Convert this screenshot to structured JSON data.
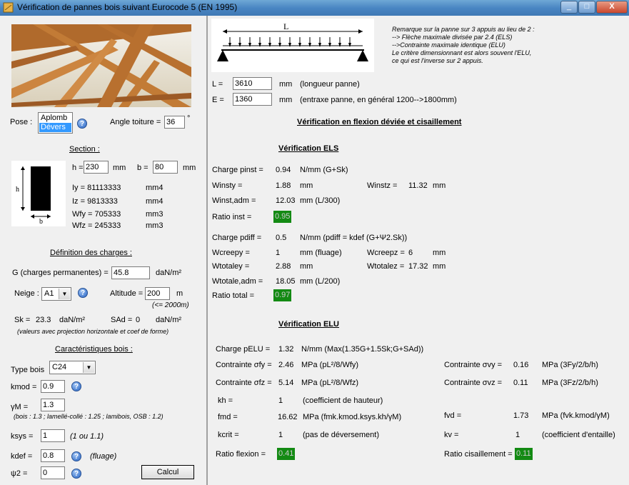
{
  "window": {
    "title": "Vérification de pannes bois suivant Eurocode 5 (EN 1995)",
    "btn_min": "_",
    "btn_max": "□",
    "btn_close": "X"
  },
  "pose": {
    "label": "Pose :",
    "options": [
      "Aplomb",
      "Dévers"
    ],
    "angle_label": "Angle toiture =",
    "angle_value": "36",
    "angle_unit": "°"
  },
  "section": {
    "heading": "Section :",
    "h_label": "h =",
    "h_value": "230",
    "h_unit": "mm",
    "b_label": "b =",
    "b_value": "80",
    "b_unit": "mm",
    "sketch_h": "h",
    "sketch_b": "b",
    "iy": "Iy = 81113333",
    "iy_unit": "mm4",
    "iz": "Iz = 9813333",
    "iz_unit": "mm4",
    "wfy": "Wfy = 705333",
    "wfy_unit": "mm3",
    "wfz": "Wfz = 245333",
    "wfz_unit": "mm3"
  },
  "charges": {
    "heading": "Définition des charges :",
    "g_label": "G (charges permanentes) =",
    "g_value": "45.8",
    "g_unit": "daN/m²",
    "neige_label": "Neige :",
    "neige_value": "A1",
    "altitude_label": "Altitude =",
    "altitude_value": "200",
    "altitude_unit": "m",
    "altitude_note": "(<= 2000m)",
    "sk_label": "Sk =",
    "sk_value": "23.3",
    "sk_unit": "daN/m²",
    "sad_label": "SAd =",
    "sad_value": "0",
    "sad_unit": "daN/m²",
    "note": "(valeurs avec projection horizontale et coef de forme)"
  },
  "bois": {
    "heading": "Caractéristiques bois :",
    "type_label": "Type bois",
    "type_value": "C24",
    "kmod_label": "kmod =",
    "kmod_value": "0.9",
    "ym_label": "γM =",
    "ym_value": "1.3",
    "ym_note": "(bois : 1.3 ; lamellé-collé : 1.25 ; lamibois, OSB : 1.2)",
    "ksys_label": "ksys =",
    "ksys_value": "1",
    "ksys_note": "(1 ou 1.1)",
    "kdef_label": "kdef =",
    "kdef_value": "0.8",
    "kdef_note": "(fluage)",
    "psi2_label": "ψ2 =",
    "psi2_value": "0",
    "calc_button": "Calcul"
  },
  "diagram": {
    "span_label": "L"
  },
  "remark": [
    "Remarque sur la panne sur 3 appuis au lieu de 2 :",
    "--> Flèche maximale divisée par 2.4 (ELS)",
    "-->Contrainte maximale identique (ELU)",
    "Le critère dimensionnant est alors souvent l'ELU,",
    "ce qui est l'inverse sur 2 appuis."
  ],
  "geometry_inputs": {
    "l_label": "L =",
    "l_value": "3610",
    "l_unit": "mm",
    "l_note": "(longueur panne)",
    "e_label": "E =",
    "e_value": "1360",
    "e_unit": "mm",
    "e_note": "(entraxe panne, en général 1200-->1800mm)"
  },
  "results": {
    "main_heading": "Vérification en flexion déviée et cisaillement",
    "els": {
      "heading": "Vérification ELS",
      "pinst_label": "Charge pinst =",
      "pinst_value": "0.94",
      "pinst_unit": "N/mm (G+Sk)",
      "winsty_label": "Winsty =",
      "winsty_value": "1.88",
      "winsty_unit": "mm",
      "winstz_label": "Winstz =",
      "winstz_value": "11.32",
      "winstz_unit": "mm",
      "winstadm_label": "Winst,adm =",
      "winstadm_value": "12.03",
      "winstadm_unit": "mm (L/300)",
      "ratio_inst_label": "Ratio inst =",
      "ratio_inst_value": "0.95",
      "pdiff_label": "Charge pdiff =",
      "pdiff_value": "0.5",
      "pdiff_unit": "N/mm (pdiff = kdef (G+Ψ2.Sk))",
      "wcreepy_label": "Wcreepy =",
      "wcreepy_value": "1",
      "wcreepy_unit": "mm (fluage)",
      "wcreepz_label": "Wcreepz =",
      "wcreepz_value": "6",
      "wcreepz_unit": "mm",
      "wtotaley_label": "Wtotaley =",
      "wtotaley_value": "2.88",
      "wtotaley_unit": "mm",
      "wtotalez_label": "Wtotalez =",
      "wtotalez_value": "17.32",
      "wtotalez_unit": "mm",
      "wtotaleadm_label": "Wtotale,adm =",
      "wtotaleadm_value": "18.05",
      "wtotaleadm_unit": "mm (L/200)",
      "ratio_total_label": "Ratio total =",
      "ratio_total_value": "0.97"
    },
    "elu": {
      "heading": "Vérification ELU",
      "pelu_label": "Charge pELU =",
      "pelu_value": "1.32",
      "pelu_unit": "N/mm (Max(1.35G+1.5Sk;G+SAd))",
      "sfy_label": "Contrainte σfy =",
      "sfy_value": "2.46",
      "sfy_unit": "MPa (pL²/8/Wfy)",
      "svy_label": "Contrainte σvy =",
      "svy_value": "0.16",
      "svy_unit": "MPa (3Fy/2/b/h)",
      "sfz_label": "Contrainte σfz =",
      "sfz_value": "5.14",
      "sfz_unit": "MPa (pL²/8/Wfz)",
      "svz_label": "Contrainte σvz =",
      "svz_value": "0.11",
      "svz_unit": "MPa (3Fz/2/b/h)",
      "kh_label": "kh =",
      "kh_value": "1",
      "kh_unit": "(coefficient de hauteur)",
      "fmd_label": "fmd =",
      "fmd_value": "16.62",
      "fmd_unit": "MPa (fmk.kmod.ksys.kh/γM)",
      "fvd_label": "fvd =",
      "fvd_value": "1.73",
      "fvd_unit": "MPa (fvk.kmod/γM)",
      "kcrit_label": "kcrit =",
      "kcrit_value": "1",
      "kcrit_unit": "(pas de déversement)",
      "kv_label": "kv =",
      "kv_value": "1",
      "kv_unit": "(coefficient d'entaille)",
      "ratio_flexion_label": "Ratio flexion =",
      "ratio_flexion_value": "0.41",
      "ratio_cis_label": "Ratio cisaillement =",
      "ratio_cis_value": "0.11"
    }
  },
  "colors": {
    "ratio_ok": "#138a13",
    "titlebar": "#4a86c3",
    "close_button": "#c9462c"
  },
  "icons": {
    "help": "help-icon",
    "app": "app-icon"
  }
}
